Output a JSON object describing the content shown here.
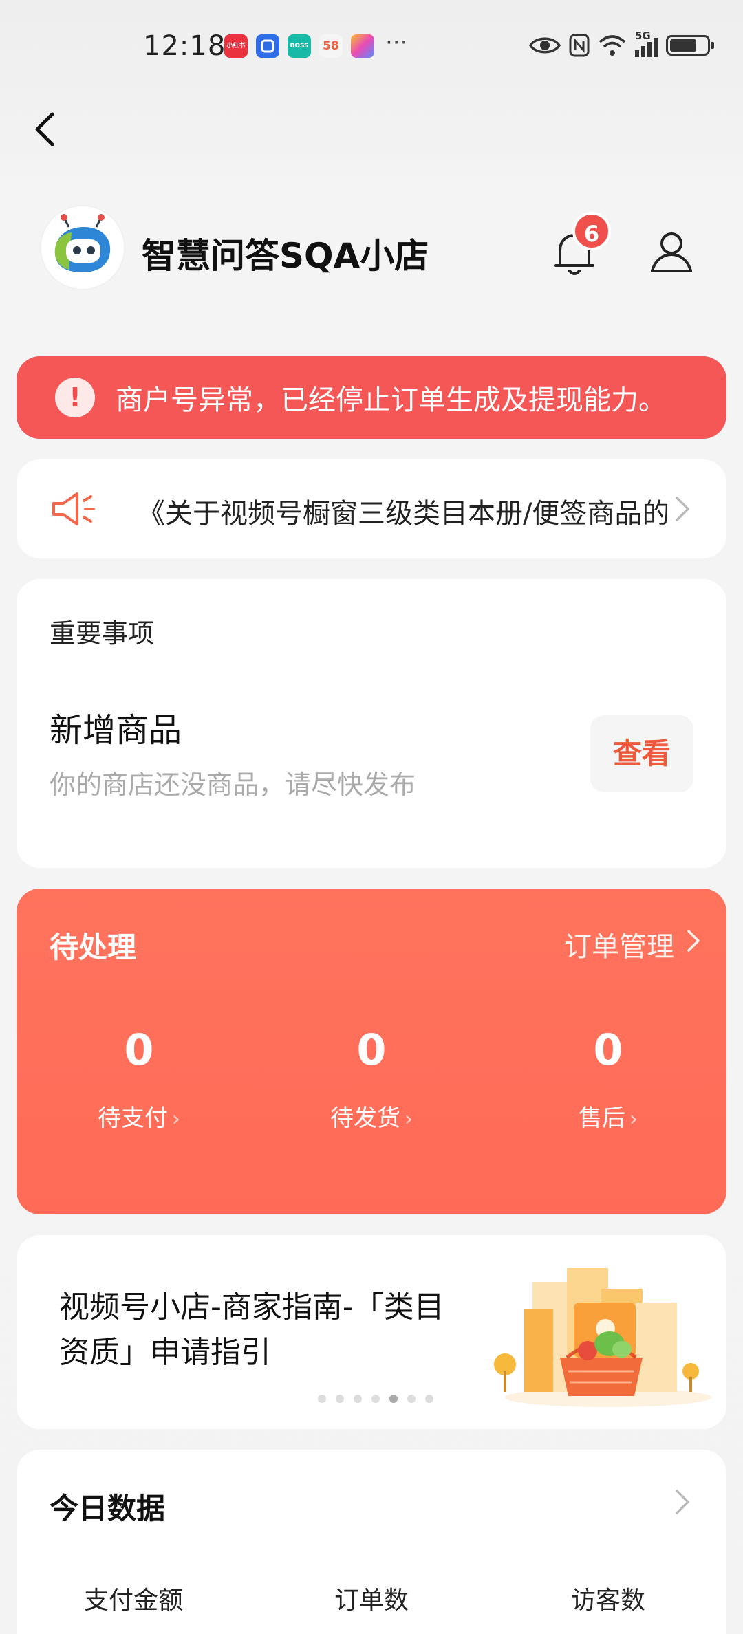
{
  "status_bar": {
    "time": "12:18",
    "apps": [
      {
        "icon": "xiaohongshu-app-icon",
        "text": "小红书",
        "color": "#e9323d"
      },
      {
        "icon": "blue-app-icon",
        "text": "",
        "color": "#2f6de8"
      },
      {
        "icon": "boss-app-icon",
        "text": "BOSS",
        "color": "#18b9a7"
      },
      {
        "icon": "58-app-icon",
        "text": "58",
        "color": "#f5f5f5"
      },
      {
        "icon": "colorful-app-icon",
        "text": "",
        "color": "#e94bb5"
      }
    ],
    "more": "···",
    "signal_label": "5G"
  },
  "shop": {
    "name": "智慧问答SQA小店",
    "notification_count": "6"
  },
  "alert": {
    "icon": "!",
    "text": "商户号异常，已经停止订单生成及提现能力。"
  },
  "notice": {
    "text": "《关于视频号橱窗三级类目本册/便签商品的规范说明》"
  },
  "important": {
    "title": "重要事项",
    "item_name": "新增商品",
    "item_desc": "你的商店还没商品，请尽快发布",
    "button": "查看"
  },
  "pending": {
    "title": "待处理",
    "link": "订单管理",
    "stats": [
      {
        "value": "0",
        "label": "待支付"
      },
      {
        "value": "0",
        "label": "待发货"
      },
      {
        "value": "0",
        "label": "售后"
      }
    ]
  },
  "guide": {
    "text": "视频号小店-商家指南-「类目资质」申请指引",
    "dot_count": 7,
    "active_dot": 4
  },
  "today": {
    "title": "今日数据",
    "labels": [
      "支付金额",
      "订单数",
      "访客数"
    ]
  }
}
